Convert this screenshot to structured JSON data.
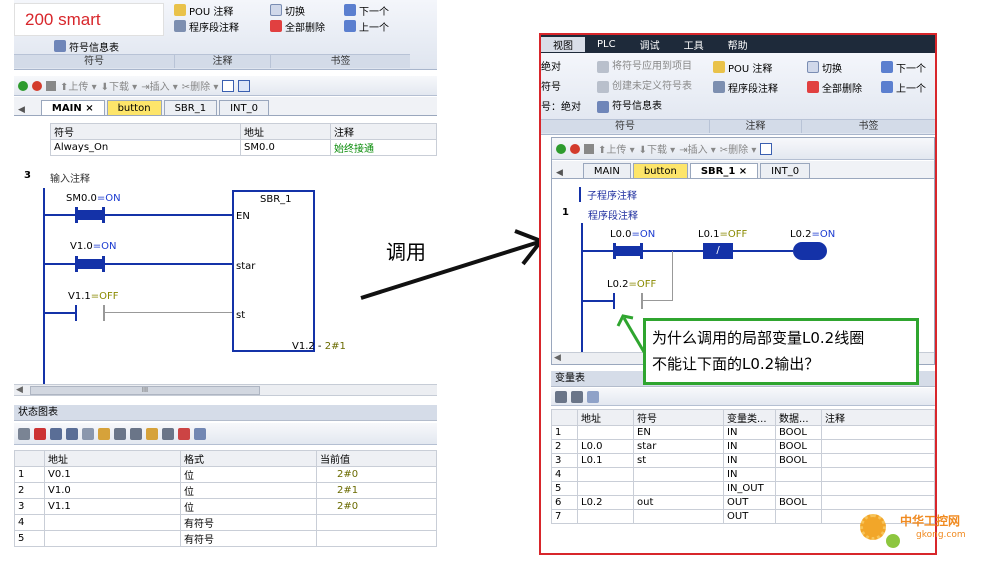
{
  "label_200smart": "200 smart",
  "arrow_label": "调用",
  "left": {
    "ribbon_top_items": [
      "符号信息表"
    ],
    "ribbon_items": {
      "pou_comment": "POU 注释",
      "network_comment": "程序段注释",
      "toggle": "切换",
      "delete_all": "全部删除",
      "next": "下一个",
      "prev": "上一个",
      "symbol_info_table": "符号信息表"
    },
    "ribbon_groups": [
      "符号",
      "注释",
      "书签"
    ],
    "toolbar": {
      "upload": "上传",
      "download": "下载",
      "insert": "插入",
      "delete": "删除"
    },
    "tabs": [
      "MAIN",
      "button",
      "SBR_1",
      "INT_0"
    ],
    "tab_close": "×",
    "symbol_table": {
      "headers": [
        "符号",
        "地址",
        "注释"
      ],
      "rows": [
        [
          "Always_On",
          "SM0.0",
          "始终接通"
        ]
      ]
    },
    "network": {
      "number": "3",
      "comment": "输入注释",
      "contacts": [
        {
          "addr": "SM0.0",
          "state": "=ON"
        },
        {
          "addr": "V1.0",
          "state": "=ON"
        },
        {
          "addr": "V1.1",
          "state": "=OFF"
        }
      ],
      "block_name": "SBR_1",
      "pins": [
        "EN",
        "star",
        "st"
      ],
      "out_label": "V1.2",
      "out_value": "2#1"
    },
    "scrollbar_grip": "III",
    "status_chart": {
      "title": "状态图表",
      "headers": [
        "",
        "地址",
        "格式",
        "当前值"
      ],
      "rows": [
        [
          "1",
          "V0.1",
          "位",
          "2#0"
        ],
        [
          "2",
          "V1.0",
          "位",
          "2#1"
        ],
        [
          "3",
          "V1.1",
          "位",
          "2#0"
        ],
        [
          "4",
          "",
          "有符号",
          ""
        ],
        [
          "5",
          "",
          "有符号",
          ""
        ]
      ]
    }
  },
  "right": {
    "menu": [
      "视图",
      "PLC",
      "调试",
      "工具",
      "帮助"
    ],
    "ribbon_col1": [
      "绝对",
      "符号",
      "号：绝对"
    ],
    "ribbon_items": {
      "apply_symbols": "将符号应用到项目",
      "create_undefined": "创建未定义符号表",
      "symbol_info_table": "符号信息表",
      "pou_comment": "POU 注释",
      "network_comment": "程序段注释",
      "toggle": "切换",
      "delete_all": "全部删除",
      "next": "下一个",
      "prev": "上一个"
    },
    "ribbon_groups": [
      "符号",
      "注释",
      "书签"
    ],
    "toolbar": {
      "upload": "上传",
      "download": "下载",
      "insert": "插入",
      "delete": "删除"
    },
    "tabs": [
      "MAIN",
      "button",
      "SBR_1",
      "INT_0"
    ],
    "tab_close": "×",
    "sub_comment": "子程序注释",
    "network": {
      "number": "1",
      "comment": "程序段注释",
      "c1": {
        "addr": "L0.0",
        "state": "=ON"
      },
      "c2": {
        "addr": "L0.1",
        "state": "=OFF"
      },
      "coil": {
        "addr": "L0.2",
        "state": "=ON"
      },
      "c3": {
        "addr": "L0.2",
        "state": "=OFF"
      }
    },
    "var_table": {
      "title": "变量表",
      "headers": [
        "",
        "地址",
        "符号",
        "变量类...",
        "数据...",
        "注释"
      ],
      "rows": [
        [
          "1",
          "",
          "EN",
          "IN",
          "BOOL",
          ""
        ],
        [
          "2",
          "L0.0",
          "star",
          "IN",
          "BOOL",
          ""
        ],
        [
          "3",
          "L0.1",
          "st",
          "IN",
          "BOOL",
          ""
        ],
        [
          "4",
          "",
          "",
          "IN",
          "",
          ""
        ],
        [
          "5",
          "",
          "",
          "IN_OUT",
          "",
          ""
        ],
        [
          "6",
          "L0.2",
          "out",
          "OUT",
          "BOOL",
          ""
        ],
        [
          "7",
          "",
          "",
          "OUT",
          "",
          ""
        ]
      ]
    }
  },
  "callout": {
    "line1": "为什么调用的局部变量L0.2线圈",
    "line2": "不能让下面的L0.2输出？"
  },
  "watermark": {
    "brand": "中华工控网",
    "url": "gkong.com"
  },
  "colors": {
    "frame_red": "#d8262b",
    "callout_green": "#2fa52f",
    "ladder_blue": "#1432a8"
  }
}
